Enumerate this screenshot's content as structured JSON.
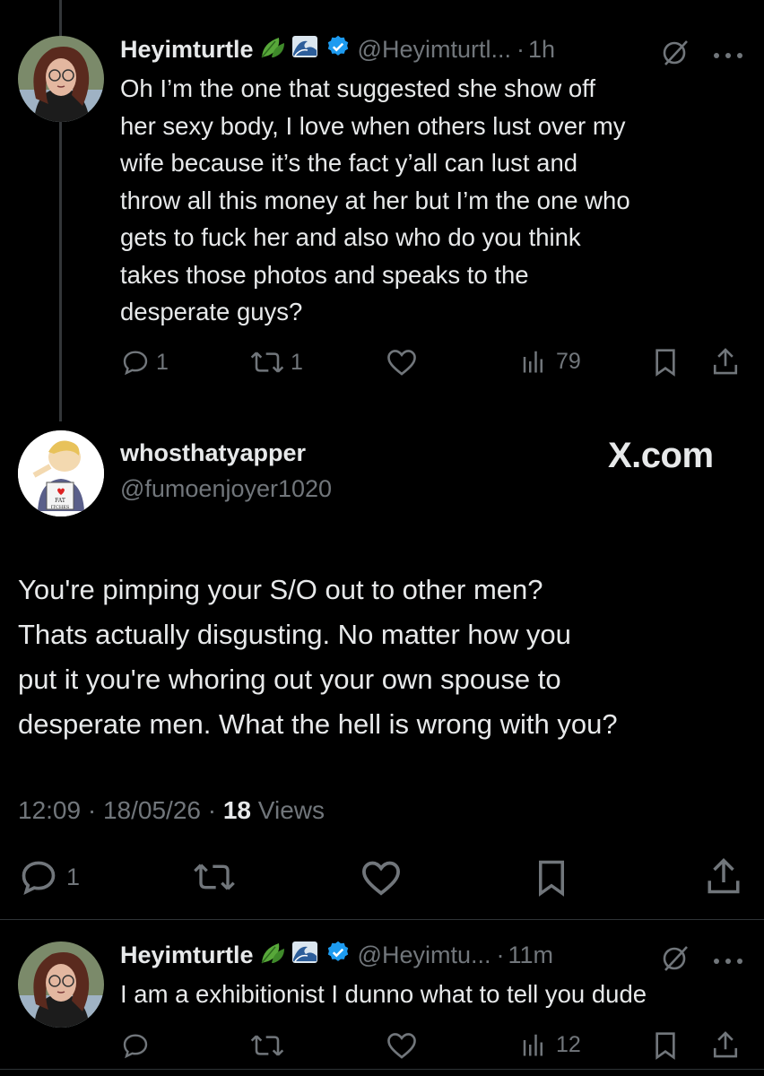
{
  "tweet1": {
    "display_name": "Heyimturtle",
    "emojis": [
      "leaf-icon",
      "wave-icon"
    ],
    "handle": "@Heyimturtl...",
    "dot": "·",
    "time": "1h",
    "text_lines": [
      "Oh I’m the one that suggested she show off",
      "her  sexy body, I love when others lust over my",
      "wife because it’s the fact y’all can lust and",
      "throw all this money at her but I’m the one who",
      "gets to fuck her and also who do you think",
      "takes those photos and speaks to the",
      "desperate guys?"
    ],
    "replies": "1",
    "reposts": "1",
    "likes": "",
    "views": "79"
  },
  "main_tweet": {
    "display_name": "whosthatyapper",
    "handle": "@fumoenjoyer1020",
    "brand": "X.com",
    "text_lines": [
      "You're pimping your S/O out to other men?",
      "Thats actually disgusting. No matter how you",
      "put it you're whoring out your own spouse to",
      "desperate men. What the hell is wrong with you?"
    ],
    "time": "12:09",
    "date": "18/05/26",
    "sep": "·",
    "views_count": "18",
    "views_label": "Views",
    "replies": "1"
  },
  "tweet3": {
    "display_name": "Heyimturtle",
    "handle": "@Heyimtu...",
    "dot": "·",
    "time": "11m",
    "text": "I am a exhibitionist I dunno what to tell you dude",
    "views": "12"
  },
  "colors": {
    "background": "#000000",
    "text": "#e7e9ea",
    "muted": "#71767b",
    "verified": "#1d9bf0"
  }
}
